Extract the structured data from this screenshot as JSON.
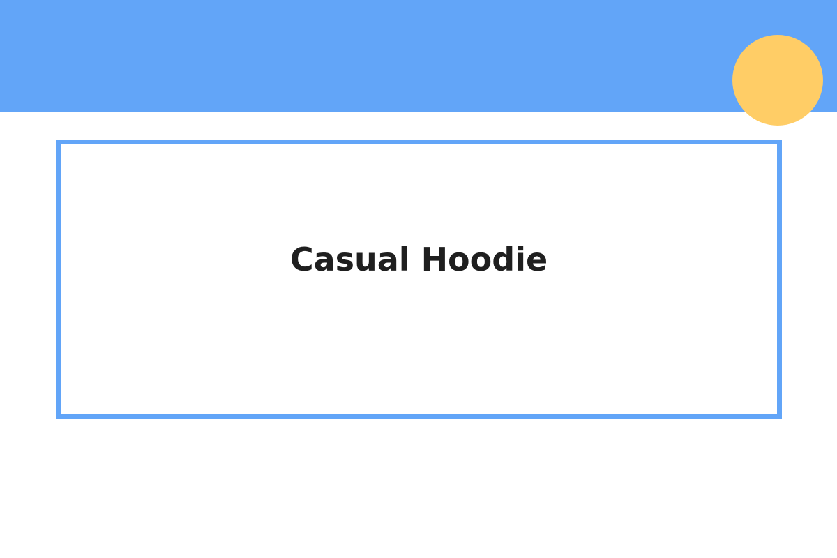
{
  "colors": {
    "banner": "#62a5f8",
    "circle": "#ffcd66",
    "frame_border": "#62a5f8",
    "background": "#ffffff",
    "title_text": "#1f1f1f"
  },
  "product": {
    "title": "Casual Hoodie"
  }
}
